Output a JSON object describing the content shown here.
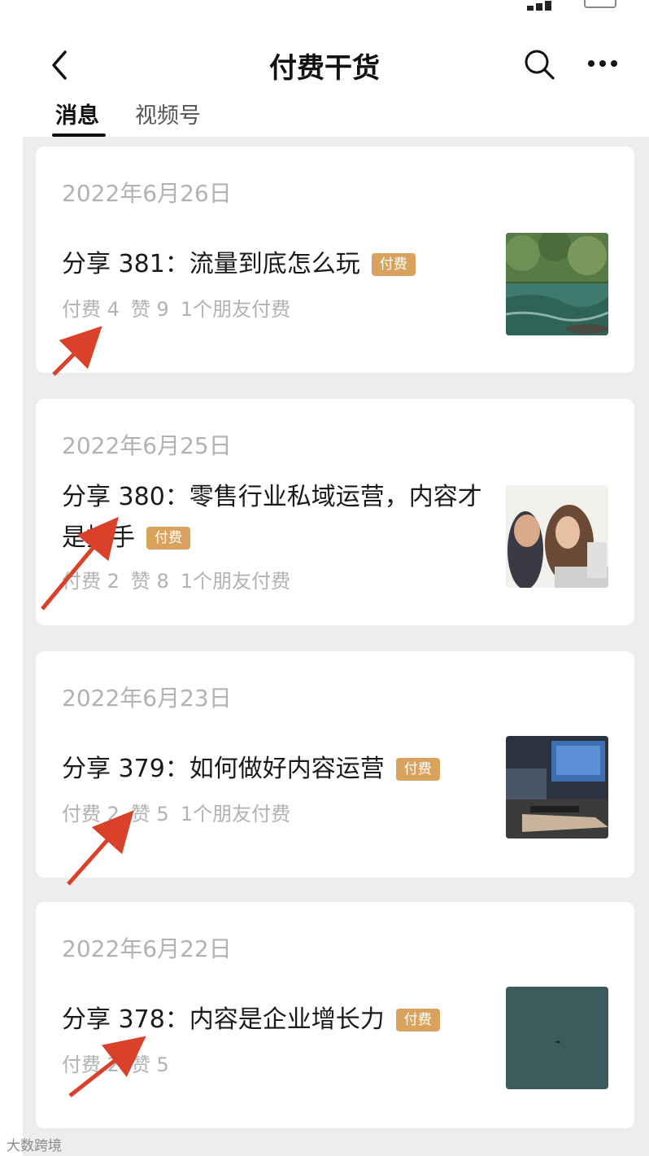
{
  "nav": {
    "title": "付费干货"
  },
  "tabs": [
    {
      "label": "消息",
      "active": true
    },
    {
      "label": "视频号",
      "active": false
    }
  ],
  "posts": [
    {
      "date": "2022年6月26日",
      "title": "分享 381：流量到底怎么玩",
      "badge": "付费",
      "pay": "付费 4",
      "likes": "赞 9",
      "friends": "1个朋友付费",
      "thumbnail": "river-forest-photo"
    },
    {
      "date": "2022年6月25日",
      "title": "分享 380：零售行业私域运营，内容才是抓手",
      "badge": "付费",
      "pay": "付费 2",
      "likes": "赞 8",
      "friends": "1个朋友付费",
      "thumbnail": "surprised-people-laptop-photo"
    },
    {
      "date": "2022年6月23日",
      "title": "分享 379：如何做好内容运营",
      "badge": "付费",
      "pay": "付费 2",
      "likes": "赞 5",
      "friends": "1个朋友付费",
      "thumbnail": "computer-workstation-photo"
    },
    {
      "date": "2022年6月22日",
      "title": "分享 378：内容是企业增长力",
      "badge": "付费",
      "pay": "付费 2",
      "likes": "赞 5",
      "thumbnail": "dark-teal-photo"
    }
  ],
  "watermark": "大数跨境",
  "colors": {
    "badge": "#d9a35e",
    "annotation_arrow": "#d9412b",
    "feed_background": "#ededed"
  }
}
